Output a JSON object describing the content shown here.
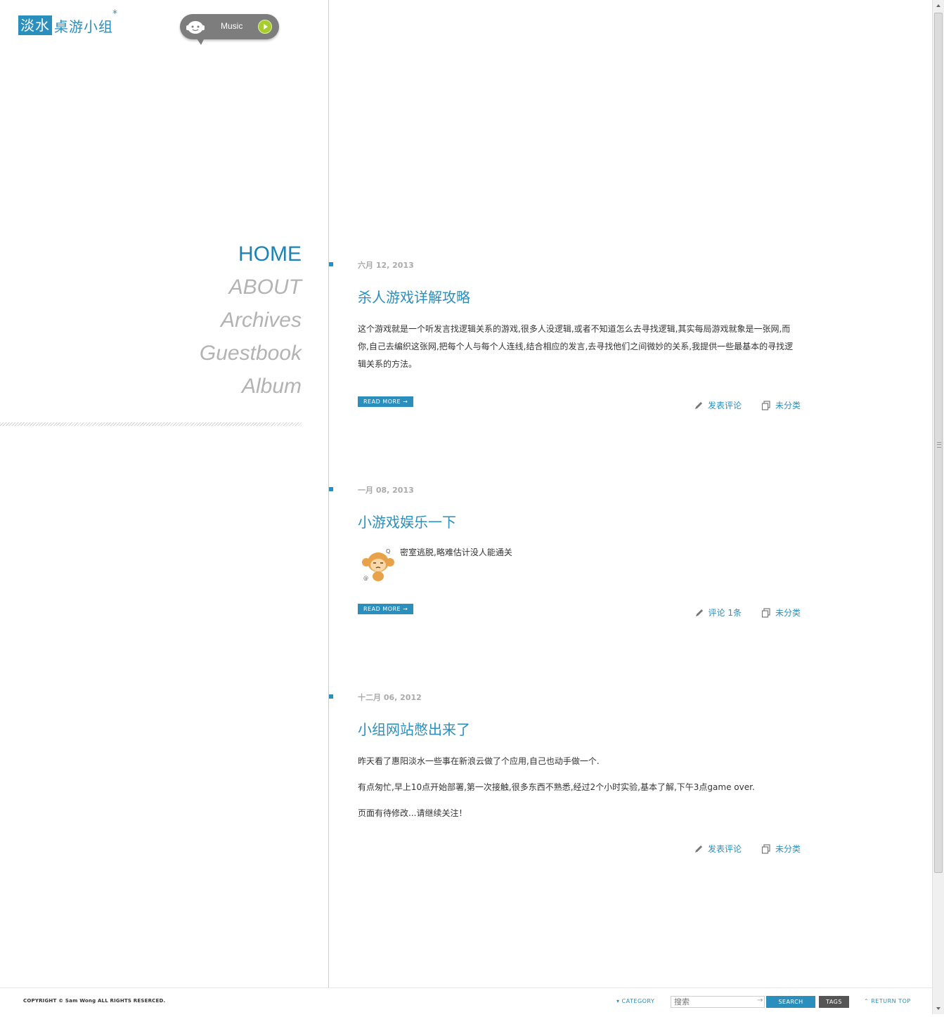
{
  "logo": {
    "boxed_text": "淡水",
    "rest_text": "桌游小组",
    "star": "*"
  },
  "music": {
    "label": "Music",
    "face_icon": "face-icon",
    "play_icon": "play-icon"
  },
  "nav": {
    "items": [
      {
        "label": "HOME",
        "active": true
      },
      {
        "label": "ABOUT",
        "active": false
      },
      {
        "label": "Archives",
        "active": false
      },
      {
        "label": "Guestbook",
        "active": false
      },
      {
        "label": "Album",
        "active": false
      }
    ]
  },
  "posts": [
    {
      "date": "六月 12, 2013",
      "title": "杀人游戏详解攻略",
      "paragraphs": [
        "这个游戏就是一个听发言找逻辑关系的游戏,很多人没逻辑,或者不知道怎么去寻找逻辑,其实每局游戏就象是一张网,而你,自己去编织这张网,把每个人与每个人连线,结合相应的发言,去寻找他们之间微妙的关系,我提供一些最基本的寻找逻辑关系的方法。"
      ],
      "read_more": "READ MORE →",
      "comment": "发表评论",
      "category": "未分类"
    },
    {
      "date": "一月 08, 2013",
      "title": "小游戏娱乐一下",
      "paragraphs": [
        "密室逃脱,略难估计没人能通关"
      ],
      "thumbnail_icon": "monkey-icon",
      "read_more": "READ MORE →",
      "comment": "评论 1条",
      "category": "未分类"
    },
    {
      "date": "十二月 06, 2012",
      "title": "小组网站憋出来了",
      "paragraphs": [
        "昨天看了惠阳淡水一些事在新浪云做了个应用,自己也动手做一个.",
        "有点匆忙,早上10点开始部署,第一次接触,很多东西不熟悉,经过2个小时实验,基本了解,下午3点game over.",
        "页面有待修改...请继续关注！"
      ],
      "comment": "发表评论",
      "category": "未分类"
    }
  ],
  "footer": {
    "copyright": "COPYRIGHT © Sam Wong ALL RIGHTS RESERCED.",
    "category": "▾ CATEGORY",
    "search_placeholder": "搜索",
    "search_arrow": "→",
    "search_button": "SEARCH",
    "tags_button": "TAGS",
    "return_top": "⌃ RETURN TOP"
  },
  "colors": {
    "accent": "#2a8fbd",
    "nav_inactive": "#b3b3b3",
    "music_bg": "#7d7d7d",
    "play_green": "#a6cc2f"
  }
}
